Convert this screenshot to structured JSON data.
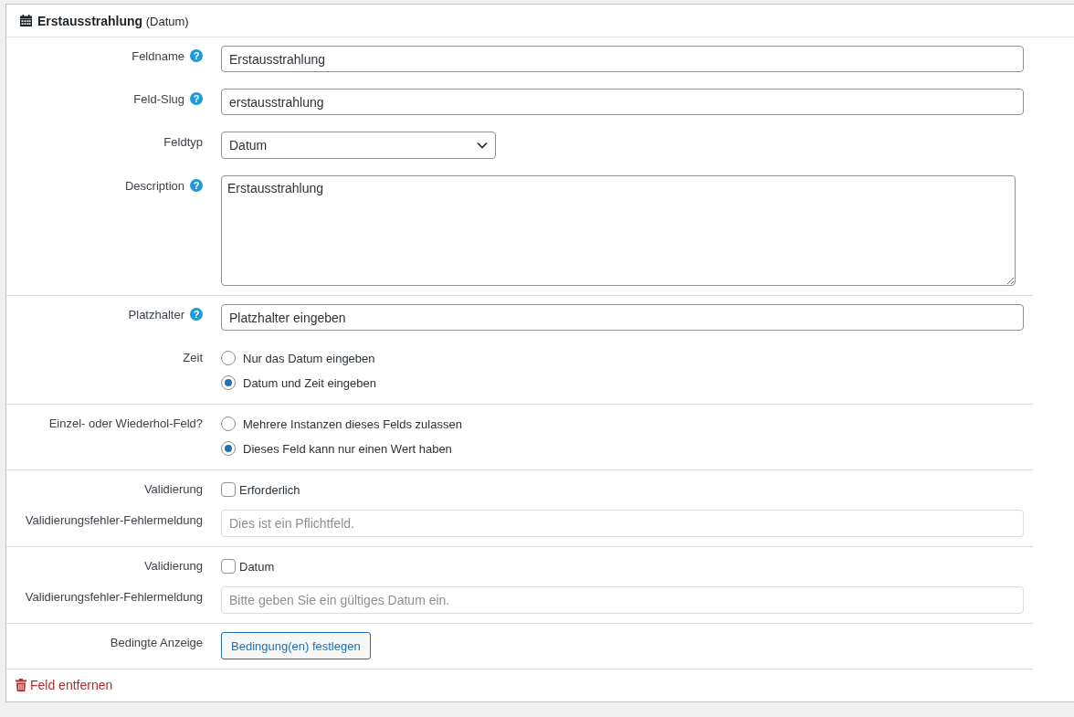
{
  "panel": {
    "title": "Erstausstrahlung",
    "type_label": "(Datum)"
  },
  "sections": [
    {
      "rows": [
        {
          "kind": "text",
          "label": "Feldname",
          "help": "?",
          "value": "Erstausstrahlung"
        },
        {
          "kind": "text",
          "label": "Feld-Slug",
          "help": "?",
          "value": "erstausstrahlung"
        },
        {
          "kind": "select",
          "label": "Feldtyp",
          "value": "Datum"
        },
        {
          "kind": "textarea",
          "label": "Description",
          "help": "?",
          "value": "Erstausstrahlung"
        }
      ]
    },
    {
      "rows": [
        {
          "kind": "text",
          "label": "Platzhalter",
          "help": "?",
          "value": "Platzhalter eingeben"
        },
        {
          "kind": "radio",
          "label": "Zeit",
          "options": [
            {
              "label": "Nur das Datum eingeben",
              "selected": false
            },
            {
              "label": "Datum und Zeit eingeben",
              "selected": true
            }
          ]
        }
      ]
    },
    {
      "rows": [
        {
          "kind": "radio",
          "label": "Einzel- oder Wiederhol-Feld?",
          "options": [
            {
              "label": "Mehrere Instanzen dieses Felds zulassen",
              "selected": false
            },
            {
              "label": "Dieses Feld kann nur einen Wert haben",
              "selected": true
            }
          ]
        }
      ]
    },
    {
      "rows": [
        {
          "kind": "checkbox",
          "label": "Validierung",
          "option": "Erforderlich",
          "checked": false
        },
        {
          "kind": "message",
          "label": "Validierungsfehler-Fehlermeldung",
          "placeholder": "Dies ist ein Pflichtfeld."
        }
      ]
    },
    {
      "rows": [
        {
          "kind": "checkbox",
          "label": "Validierung",
          "option": "Datum",
          "checked": false
        },
        {
          "kind": "message",
          "label": "Validierungsfehler-Fehlermeldung",
          "placeholder": "Bitte geben Sie ein gültiges Datum ein."
        }
      ]
    },
    {
      "rows": [
        {
          "kind": "button",
          "label": "Bedingte Anzeige",
          "button": "Bedingung(en) festlegen"
        }
      ]
    }
  ],
  "footer": {
    "remove_link": "Feld entfernen"
  }
}
